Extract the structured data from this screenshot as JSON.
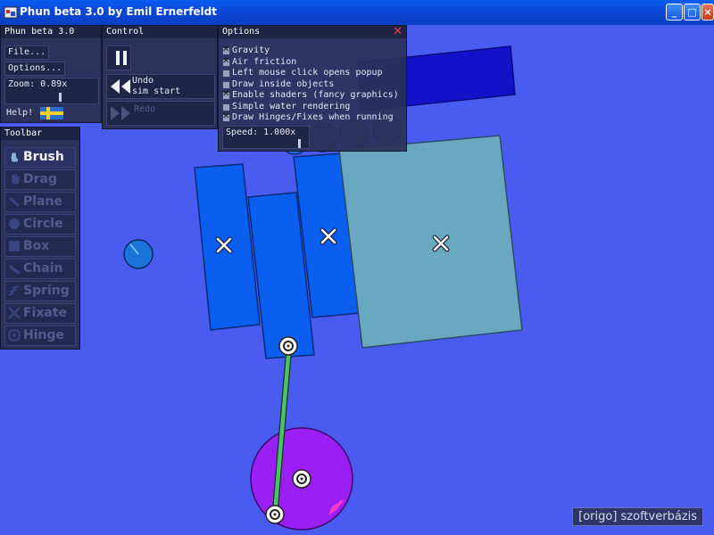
{
  "window": {
    "title": "Phun beta 3.0 by Emil Ernerfeldt"
  },
  "main_panel": {
    "title": "Phun beta 3.0",
    "file_label": "File...",
    "options_label": "Options...",
    "zoom_label": "Zoom: 0.89x",
    "help_label": "Help!"
  },
  "control": {
    "title": "Control",
    "undo_label": "Undo",
    "undo_sub": "sim start",
    "redo_label": "Redo"
  },
  "options": {
    "title": "Options",
    "items": [
      {
        "label": "Gravity",
        "checked": true
      },
      {
        "label": "Air friction",
        "checked": true
      },
      {
        "label": "Left mouse click opens popup",
        "checked": false
      },
      {
        "label": "Draw inside objects",
        "checked": false
      },
      {
        "label": "Enable shaders (fancy graphics)",
        "checked": true
      },
      {
        "label": "Simple water rendering",
        "checked": false
      },
      {
        "label": "Draw Hinges/Fixes when running",
        "checked": true
      }
    ],
    "speed_label": "Speed: 1.000x"
  },
  "toolbar": {
    "title": "Toolbar",
    "tools": [
      {
        "label": "Brush",
        "icon": "brush-icon",
        "active": true
      },
      {
        "label": "Drag",
        "icon": "drag-hand-icon",
        "active": false
      },
      {
        "label": "Plane",
        "icon": "plane-icon",
        "active": false
      },
      {
        "label": "Circle",
        "icon": "circle-icon",
        "active": false
      },
      {
        "label": "Box",
        "icon": "box-icon",
        "active": false
      },
      {
        "label": "Chain",
        "icon": "chain-icon",
        "active": false
      },
      {
        "label": "Spring",
        "icon": "spring-icon",
        "active": false
      },
      {
        "label": "Fixate",
        "icon": "fixate-icon",
        "active": false
      },
      {
        "label": "Hinge",
        "icon": "hinge-icon",
        "active": false
      }
    ]
  },
  "watermark": {
    "text": "[origo] szoftverbázis"
  },
  "colors": {
    "background": "#4a5cf0",
    "box_blue": "#0a5ef0",
    "box_teal": "#6aa8c0",
    "circle_purple": "#9b1ff5",
    "rod_green": "#4ec06a",
    "accent_pink": "#ff3cc8"
  }
}
